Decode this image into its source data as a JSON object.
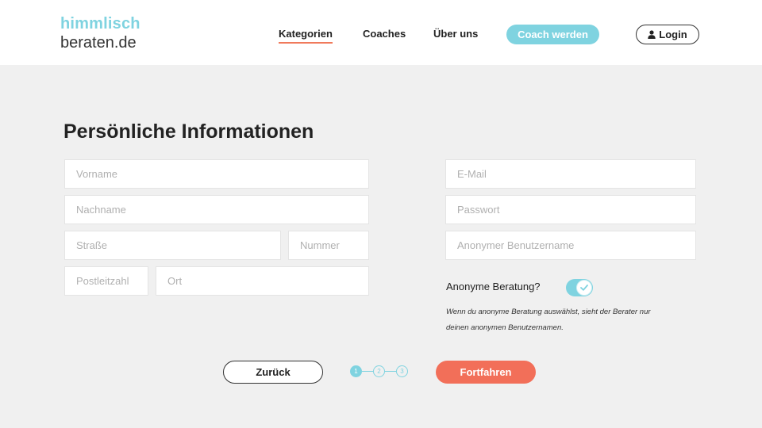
{
  "logo": {
    "line1": "himmlisch",
    "line2": "beraten.de"
  },
  "nav": {
    "kategorien": "Kategorien",
    "coaches": "Coaches",
    "ueber_uns": "Über uns",
    "coach_werden": "Coach werden",
    "login": "Login"
  },
  "form": {
    "title": "Persönliche Informationen",
    "vorname_placeholder": "Vorname",
    "nachname_placeholder": "Nachname",
    "strasse_placeholder": "Straße",
    "nummer_placeholder": "Nummer",
    "plz_placeholder": "Postleitzahl",
    "ort_placeholder": "Ort",
    "email_placeholder": "E-Mail",
    "passwort_placeholder": "Passwort",
    "anon_username_placeholder": "Anonymer Benutzername",
    "anon_label": "Anonyme Beratung?",
    "anon_enabled": true,
    "anon_hint": "Wenn du anonyme Beratung auswählst, sieht der Berater nur deinen anonymen Benutzernamen."
  },
  "steps": {
    "items": [
      "1",
      "2",
      "3"
    ],
    "current": 1
  },
  "actions": {
    "back": "Zurück",
    "next": "Fortfahren"
  },
  "colors": {
    "accent": "#7fd3e0",
    "primary_button": "#f26f59",
    "nav_underline": "#f07a5c"
  },
  "icons": {
    "login": "user-icon",
    "toggle": "check-icon"
  }
}
